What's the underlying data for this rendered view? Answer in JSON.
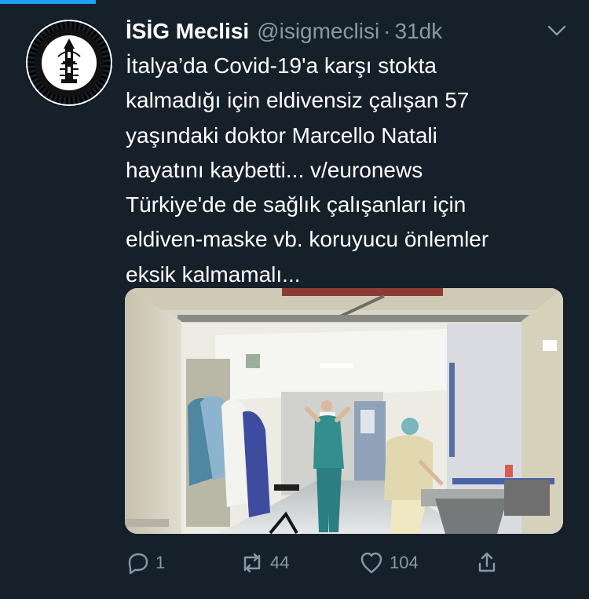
{
  "colors": {
    "background": "#15202b",
    "primary_text": "#ffffff",
    "secondary_text": "#8899a6",
    "accent": "#1da1f2"
  },
  "tweet": {
    "author": {
      "display_name": "İSİG Meclisi",
      "handle": "@isigmeclisi",
      "avatar_icon": "isig-meclisi-logo"
    },
    "separator": "·",
    "timestamp": "31dk",
    "menu_icon": "chevron-down-icon",
    "text": "İtalya’da Covid-19'a karşı stokta\nkalmadığı için eldivensiz çalışan 57\nyaşındaki doktor Marcello Natali\nhayatını kaybetti... v/euronews\nTürkiye'de de sağlık çalışanları için\neldiven-maske vb. koruyucu önlemler\neksik kalmamalı...",
    "media": {
      "type": "photo",
      "icon": "photo-image"
    },
    "actions": {
      "reply": {
        "icon": "reply-icon",
        "count": "1"
      },
      "retweet": {
        "icon": "retweet-icon",
        "count": "44"
      },
      "like": {
        "icon": "heart-icon",
        "count": "104"
      },
      "share": {
        "icon": "share-icon"
      }
    }
  }
}
